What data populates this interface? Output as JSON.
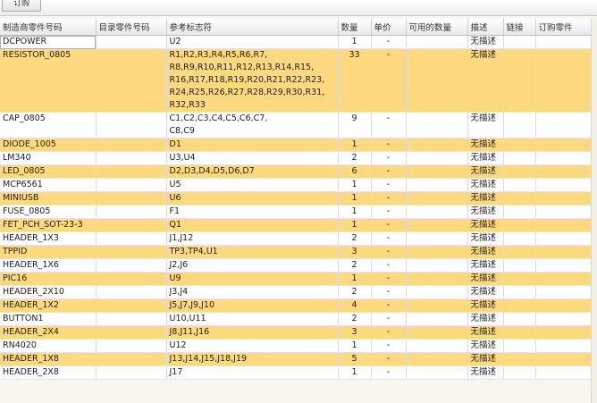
{
  "toolbar": {
    "order_button": "订购"
  },
  "table": {
    "headers": [
      "制造商零件号码",
      "目录零件号码",
      "参考标志符",
      "数量",
      "单价",
      "可用的数量",
      "描述",
      "链接",
      "订购零件"
    ],
    "rows": [
      {
        "mfr": "DCPOWER",
        "cat": "",
        "refs": [
          "U2"
        ],
        "qty": "1",
        "price": "-",
        "desc": "无描述"
      },
      {
        "mfr": "RESISTOR_0805",
        "cat": "",
        "refs": [
          "R1,R2,R3,R4,R5,R6,R7,",
          "R8,R9,R10,R11,R12,R13,R14,R15,",
          "R16,R17,R18,R19,R20,R21,R22,R23,",
          "R24,R25,R26,R27,R28,R29,R30,R31,",
          "R32,R33"
        ],
        "qty": "33",
        "price": "-",
        "desc": "无描述"
      },
      {
        "mfr": "CAP_0805",
        "cat": "",
        "refs": [
          "C1,C2,C3,C4,C5,C6,C7,",
          "C8,C9"
        ],
        "qty": "9",
        "price": "-",
        "desc": "无描述"
      },
      {
        "mfr": "DIODE_1005",
        "cat": "",
        "refs": [
          "D1"
        ],
        "qty": "1",
        "price": "-",
        "desc": "无描述"
      },
      {
        "mfr": "LM340",
        "cat": "",
        "refs": [
          "U3,U4"
        ],
        "qty": "2",
        "price": "-",
        "desc": "无描述"
      },
      {
        "mfr": "LED_0805",
        "cat": "",
        "refs": [
          "D2,D3,D4,D5,D6,D7"
        ],
        "qty": "6",
        "price": "-",
        "desc": "无描述"
      },
      {
        "mfr": "MCP6561",
        "cat": "",
        "refs": [
          "U5"
        ],
        "qty": "1",
        "price": "-",
        "desc": "无描述"
      },
      {
        "mfr": "MINIUSB",
        "cat": "",
        "refs": [
          "U6"
        ],
        "qty": "1",
        "price": "-",
        "desc": "无描述"
      },
      {
        "mfr": "FUSE_0805",
        "cat": "",
        "refs": [
          "F1"
        ],
        "qty": "1",
        "price": "-",
        "desc": "无描述"
      },
      {
        "mfr": "FET_PCH_SOT-23-3",
        "cat": "",
        "refs": [
          "Q1"
        ],
        "qty": "1",
        "price": "-",
        "desc": "无描述"
      },
      {
        "mfr": "HEADER_1X3",
        "cat": "",
        "refs": [
          "J1,J12"
        ],
        "qty": "2",
        "price": "-",
        "desc": "无描述"
      },
      {
        "mfr": "TPPID",
        "cat": "",
        "refs": [
          "TP3,TP4,U1"
        ],
        "qty": "3",
        "price": "-",
        "desc": "无描述"
      },
      {
        "mfr": "HEADER_1X6",
        "cat": "",
        "refs": [
          "J2,J6"
        ],
        "qty": "2",
        "price": "-",
        "desc": "无描述"
      },
      {
        "mfr": "PIC16",
        "cat": "",
        "refs": [
          "U9"
        ],
        "qty": "1",
        "price": "-",
        "desc": "无描述"
      },
      {
        "mfr": "HEADER_2X10",
        "cat": "",
        "refs": [
          "J3,J4"
        ],
        "qty": "2",
        "price": "-",
        "desc": "无描述"
      },
      {
        "mfr": "HEADER_1X2",
        "cat": "",
        "refs": [
          "J5,J7,J9,J10"
        ],
        "qty": "4",
        "price": "-",
        "desc": "无描述"
      },
      {
        "mfr": "BUTTON1",
        "cat": "",
        "refs": [
          "U10,U11"
        ],
        "qty": "2",
        "price": "-",
        "desc": "无描述"
      },
      {
        "mfr": "HEADER_2X4",
        "cat": "",
        "refs": [
          "J8,J11,J16"
        ],
        "qty": "3",
        "price": "-",
        "desc": "无描述"
      },
      {
        "mfr": "RN4020",
        "cat": "",
        "refs": [
          "U12"
        ],
        "qty": "1",
        "price": "-",
        "desc": "无描述"
      },
      {
        "mfr": "HEADER_1X8",
        "cat": "",
        "refs": [
          "J13,J14,J15,J18,J19"
        ],
        "qty": "5",
        "price": "-",
        "desc": "无描述"
      },
      {
        "mfr": "HEADER_2X8",
        "cat": "",
        "refs": [
          "J17"
        ],
        "qty": "1",
        "price": "-",
        "desc": "无描述"
      }
    ]
  },
  "colors": {
    "row_highlight": "#ffd97f",
    "row_plain": "#ffffff",
    "background": "#faf6ee"
  }
}
